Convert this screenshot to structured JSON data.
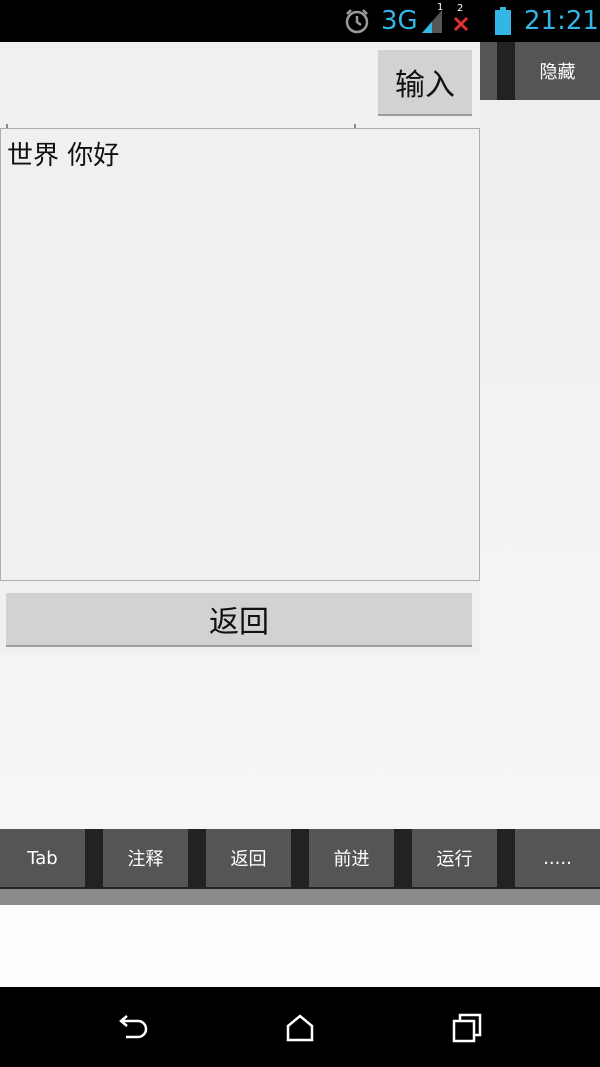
{
  "status_bar": {
    "network": "3G",
    "signal_sim1": "1",
    "signal_sim2": "2",
    "time": "21:21",
    "accent_color": "#33b5e5",
    "icons": [
      "alarm-icon",
      "signal-icon",
      "no-signal-icon",
      "battery-icon"
    ]
  },
  "top_toolbar": {
    "hide_label": "隐藏"
  },
  "dialog": {
    "input_value": "",
    "input_button_label": "输入",
    "output_text": "世界 你好",
    "back_button_label": "返回"
  },
  "bottom_toolbar": {
    "buttons": [
      "Tab",
      "注释",
      "返回",
      "前进",
      "运行",
      "....."
    ]
  },
  "nav_bar": {
    "icons": [
      "back-icon",
      "home-icon",
      "recents-icon"
    ]
  }
}
